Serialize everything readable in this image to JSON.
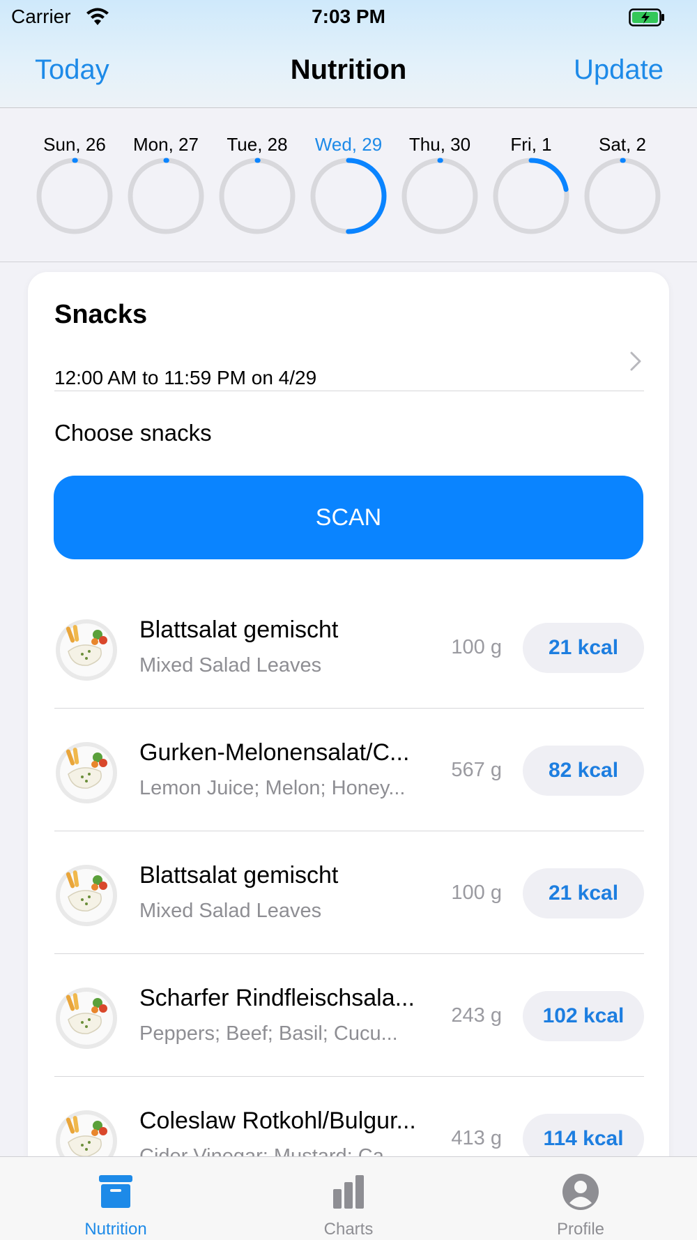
{
  "status_bar": {
    "carrier": "Carrier",
    "time": "7:03 PM"
  },
  "nav": {
    "left": "Today",
    "title": "Nutrition",
    "right": "Update"
  },
  "week": [
    {
      "label": "Sun, 26",
      "progress": 0,
      "selected": false
    },
    {
      "label": "Mon, 27",
      "progress": 0,
      "selected": false
    },
    {
      "label": "Tue, 28",
      "progress": 0,
      "selected": false
    },
    {
      "label": "Wed, 29",
      "progress": 0.5,
      "selected": true
    },
    {
      "label": "Thu, 30",
      "progress": 0,
      "selected": false
    },
    {
      "label": "Fri, 1",
      "progress": 0.22,
      "selected": false
    },
    {
      "label": "Sat, 2",
      "progress": 0,
      "selected": false
    }
  ],
  "meal": {
    "title": "Snacks",
    "range": "12:00 AM to 11:59 PM on 4/29",
    "choose_label": "Choose snacks",
    "scan_label": "SCAN"
  },
  "foods": [
    {
      "name": "Blattsalat gemischt",
      "desc": "Mixed Salad Leaves",
      "weight": "100 g",
      "kcal": "21 kcal"
    },
    {
      "name": "Gurken-Melonensalat/C...",
      "desc": "Lemon Juice; Melon; Honey...",
      "weight": "567 g",
      "kcal": "82 kcal"
    },
    {
      "name": "Blattsalat gemischt",
      "desc": "Mixed Salad Leaves",
      "weight": "100 g",
      "kcal": "21 kcal"
    },
    {
      "name": "Scharfer Rindfleischsala...",
      "desc": "Peppers; Beef; Basil; Cucu...",
      "weight": "243 g",
      "kcal": "102 kcal"
    },
    {
      "name": "Coleslaw Rotkohl/Bulgur...",
      "desc": "Cider Vinegar; Mustard; Ca...",
      "weight": "413 g",
      "kcal": "114 kcal"
    }
  ],
  "tabs": [
    {
      "label": "Nutrition",
      "icon": "archive-box-icon",
      "active": true
    },
    {
      "label": "Charts",
      "icon": "bar-chart-icon",
      "active": false
    },
    {
      "label": "Profile",
      "icon": "person-circle-icon",
      "active": false
    }
  ],
  "colors": {
    "accent": "#0a84ff",
    "link": "#1d8ae8",
    "ring_track": "#d8d8dc",
    "secondary_text": "#8e8e93"
  }
}
